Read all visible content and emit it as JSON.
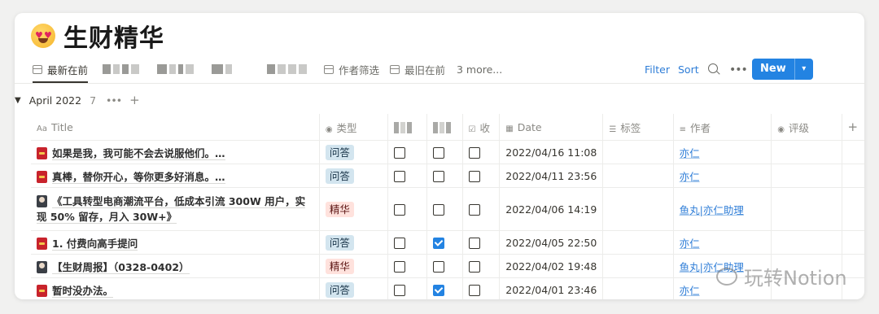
{
  "page": {
    "title": "生财精华"
  },
  "views": {
    "tabs": [
      {
        "label": "最新在前",
        "active": true
      },
      {
        "label": "作者筛选",
        "active": false
      },
      {
        "label": "最旧在前",
        "active": false
      }
    ],
    "more": "3 more..."
  },
  "toolbar": {
    "filter": "Filter",
    "sort": "Sort",
    "new_label": "New"
  },
  "group": {
    "name": "April 2022",
    "count": "7"
  },
  "columns": {
    "title": "Title",
    "type": "类型",
    "checked": "收",
    "date": "Date",
    "tags": "标签",
    "author": "作者",
    "rating": "评级"
  },
  "rows": [
    {
      "icon": "red-envelope-icon",
      "title": "如果是我，我可能不会去说服他们。…",
      "type": "问答",
      "c1": false,
      "c2": false,
      "c3": false,
      "date": "2022/04/16 11:08",
      "tags": "",
      "author": "亦仁",
      "rating": ""
    },
    {
      "icon": "red-envelope-icon",
      "title": "真棒，替你开心，等你更多好消息。…",
      "type": "问答",
      "c1": false,
      "c2": false,
      "c3": false,
      "date": "2022/04/11 23:56",
      "tags": "",
      "author": "亦仁",
      "rating": ""
    },
    {
      "icon": "portrait-icon",
      "title": "《工具转型电商潮流平台，低成本引流 300W 用户，实现 50% 留存，月入 30W+》",
      "type": "精华",
      "c1": false,
      "c2": false,
      "c3": false,
      "date": "2022/04/06 14:19",
      "tags": "",
      "author": "鱼丸|亦仁助理",
      "rating": ""
    },
    {
      "icon": "red-envelope-icon",
      "title": "1. 付费向高手提问",
      "type": "问答",
      "c1": false,
      "c2": true,
      "c3": false,
      "date": "2022/04/05 22:50",
      "tags": "",
      "author": "亦仁",
      "rating": ""
    },
    {
      "icon": "portrait-icon",
      "title": "【生财周报】（0328-0402）",
      "type": "精华",
      "c1": false,
      "c2": false,
      "c3": false,
      "date": "2022/04/02 19:48",
      "tags": "",
      "author": "鱼丸|亦仁助理",
      "rating": ""
    },
    {
      "icon": "red-envelope-icon",
      "title": "暂时没办法。",
      "type": "问答",
      "c1": false,
      "c2": true,
      "c3": false,
      "date": "2022/04/01 23:46",
      "tags": "",
      "author": "亦仁",
      "rating": ""
    }
  ],
  "watermark": "玩转Notion"
}
